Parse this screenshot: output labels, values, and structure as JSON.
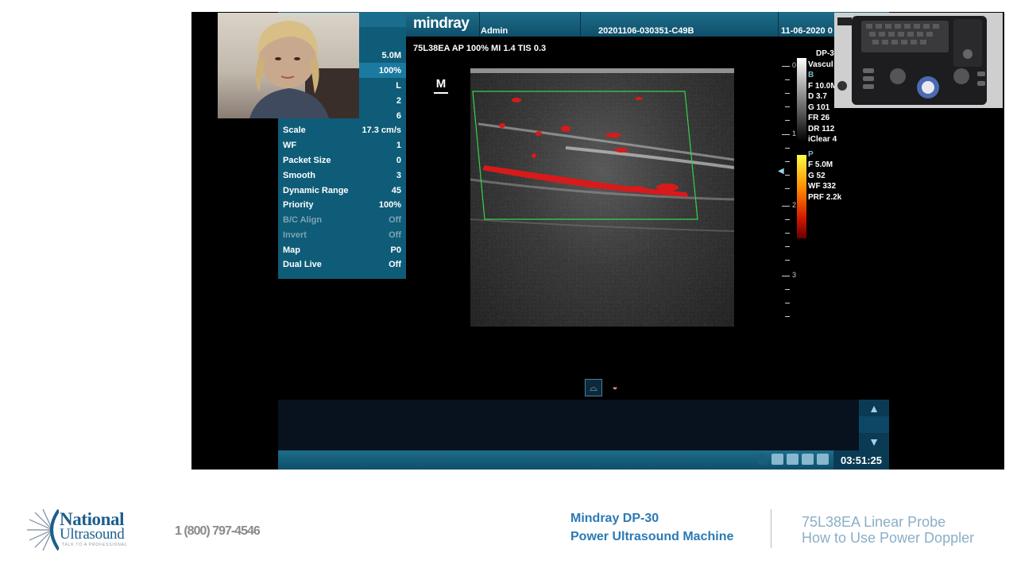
{
  "header": {
    "brand": "mindray",
    "user": "Admin",
    "exam_id": "20201106-030351-C49B",
    "date": "11-06-2020 0"
  },
  "menu": {
    "top_values": [
      {
        "label": "",
        "value": "5.0M"
      },
      {
        "label": "",
        "value": "100%"
      },
      {
        "label": "",
        "value": "L"
      },
      {
        "label": "",
        "value": "2"
      },
      {
        "label": "",
        "value": "6"
      }
    ],
    "items": [
      {
        "label": "Scale",
        "value": "17.3 cm/s"
      },
      {
        "label": "WF",
        "value": "1"
      },
      {
        "label": "Packet Size",
        "value": "0"
      },
      {
        "label": "Smooth",
        "value": "3"
      },
      {
        "label": "Dynamic Range",
        "value": "45"
      },
      {
        "label": "Priority",
        "value": "100%"
      },
      {
        "label": "B/C Align",
        "value": "Off"
      },
      {
        "label": "Invert",
        "value": "Off"
      },
      {
        "label": "Map",
        "value": "P0"
      },
      {
        "label": "Dual Live",
        "value": "Off"
      }
    ]
  },
  "params_line": "75L38EA AP 100% MI 1.4 TIS 0.3",
  "m_marker": "M",
  "depth_labels": [
    "0",
    "1",
    "2",
    "3"
  ],
  "right_panel": {
    "header": "DP-3",
    "mode": "Vascul",
    "b_label": "B",
    "b_values": [
      "F 10.0M",
      "D 3.7",
      "G 101",
      "FR 26",
      "DR 112",
      "iClear 4"
    ],
    "p_label": "P",
    "p_values": [
      "F 5.0M",
      "G 52",
      "WF 332",
      "PRF 2.2k"
    ]
  },
  "status": {
    "clock": "03:51:25"
  },
  "footer": {
    "logo_line1": "National",
    "logo_line2": "Ultrasound",
    "logo_tagline": "TALK TO A PROFESSIONAL",
    "phone": "1 (800) 797-4546",
    "title_line1": "Mindray DP-30",
    "title_line2": "Power Ultrasound Machine",
    "subtitle_line1": "75L38EA Linear Probe",
    "subtitle_line2": "How to Use Power Doppler"
  },
  "colors": {
    "panel": "#0e5c78",
    "footer_blue": "#2a7ab5",
    "footer_light": "#8aaec8",
    "doppler_red": "#d81a1a",
    "roi_green": "#35d44a"
  }
}
